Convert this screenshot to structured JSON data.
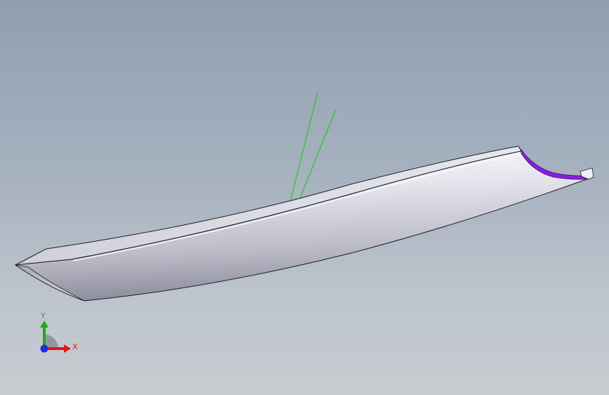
{
  "viewport": {
    "background_top": "#8f9eb0",
    "background_bottom": "#c8ccd1"
  },
  "model": {
    "body_color": "#c8c9d2",
    "edge_color": "#1c1c24",
    "highlight_color": "#f4f4f8",
    "cut_face_color": "#8a1fe0",
    "sketch_line_color": "#22cc22"
  },
  "triad": {
    "x_label": "X",
    "y_label": "Y",
    "x_color": "#e01515",
    "y_color": "#1faa1f",
    "z_color": "#1f2ae0"
  }
}
